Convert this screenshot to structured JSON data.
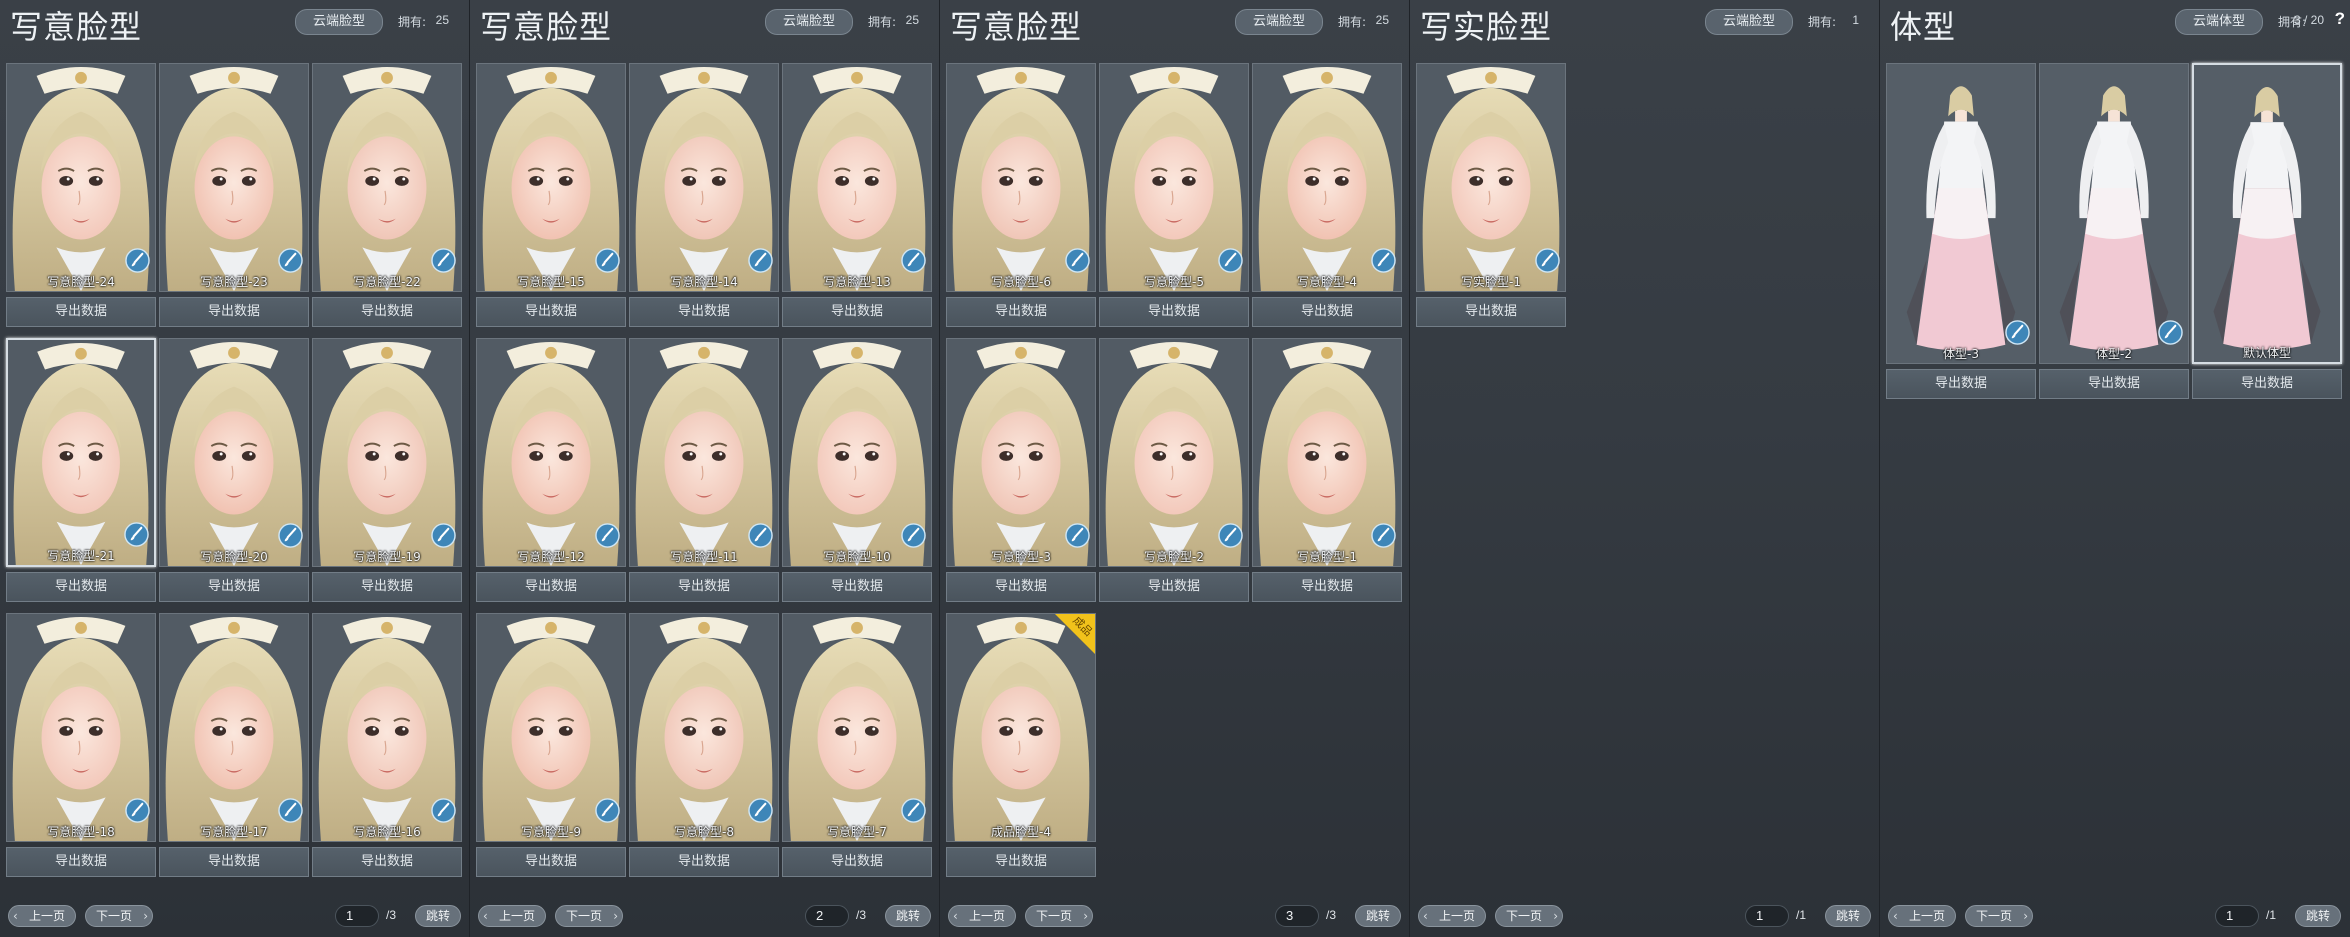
{
  "common": {
    "export_label": "导出数据",
    "owned_label": "拥有:",
    "prev_label": "上一页",
    "next_label": "下一页",
    "jump_label": "跳转"
  },
  "panels": [
    {
      "title": "写意脸型",
      "cloud_button": "云端脸型",
      "owned": "25",
      "page_current": "1",
      "page_total": "/3",
      "items": [
        {
          "label": "写意脸型-24",
          "kind": "face",
          "brush": true,
          "selected": false
        },
        {
          "label": "写意脸型-23",
          "kind": "face",
          "brush": true,
          "selected": false
        },
        {
          "label": "写意脸型-22",
          "kind": "face",
          "brush": true,
          "selected": false
        },
        {
          "label": "写意脸型-21",
          "kind": "face",
          "brush": true,
          "selected": true
        },
        {
          "label": "写意脸型-20",
          "kind": "face",
          "brush": true,
          "selected": false
        },
        {
          "label": "写意脸型-19",
          "kind": "face",
          "brush": true,
          "selected": false
        },
        {
          "label": "写意脸型-18",
          "kind": "face",
          "brush": true,
          "selected": false
        },
        {
          "label": "写意脸型-17",
          "kind": "face",
          "brush": true,
          "selected": false
        },
        {
          "label": "写意脸型-16",
          "kind": "face",
          "brush": true,
          "selected": false
        }
      ]
    },
    {
      "title": "写意脸型",
      "cloud_button": "云端脸型",
      "owned": "25",
      "page_current": "2",
      "page_total": "/3",
      "items": [
        {
          "label": "写意脸型-15",
          "kind": "face",
          "brush": true,
          "selected": false
        },
        {
          "label": "写意脸型-14",
          "kind": "face",
          "brush": true,
          "selected": false
        },
        {
          "label": "写意脸型-13",
          "kind": "face",
          "brush": true,
          "selected": false
        },
        {
          "label": "写意脸型-12",
          "kind": "face",
          "brush": true,
          "selected": false
        },
        {
          "label": "写意脸型-11",
          "kind": "face",
          "brush": true,
          "selected": false
        },
        {
          "label": "写意脸型-10",
          "kind": "face",
          "brush": true,
          "selected": false
        },
        {
          "label": "写意脸型-9",
          "kind": "face",
          "brush": true,
          "selected": false
        },
        {
          "label": "写意脸型-8",
          "kind": "face",
          "brush": true,
          "selected": false
        },
        {
          "label": "写意脸型-7",
          "kind": "face",
          "brush": true,
          "selected": false
        }
      ]
    },
    {
      "title": "写意脸型",
      "cloud_button": "云端脸型",
      "owned": "25",
      "page_current": "3",
      "page_total": "/3",
      "items": [
        {
          "label": "写意脸型-6",
          "kind": "face",
          "brush": true,
          "selected": false
        },
        {
          "label": "写意脸型-5",
          "kind": "face",
          "brush": true,
          "selected": false
        },
        {
          "label": "写意脸型-4",
          "kind": "face",
          "brush": true,
          "selected": false
        },
        {
          "label": "写意脸型-3",
          "kind": "face",
          "brush": true,
          "selected": false
        },
        {
          "label": "写意脸型-2",
          "kind": "face",
          "brush": true,
          "selected": false
        },
        {
          "label": "写意脸型-1",
          "kind": "face",
          "brush": true,
          "selected": false
        },
        {
          "label": "成品脸型-4",
          "kind": "face",
          "brush": false,
          "selected": false,
          "badge": "成品"
        }
      ]
    },
    {
      "title": "写实脸型",
      "cloud_button": "云端脸型",
      "owned": "1",
      "page_current": "1",
      "page_total": "/1",
      "items": [
        {
          "label": "写实脸型-1",
          "kind": "face",
          "brush": true,
          "selected": false
        }
      ]
    },
    {
      "title": "体型",
      "cloud_button": "云端体型",
      "owned": "3 / 20",
      "help": "?",
      "page_current": "1",
      "page_total": "/1",
      "items": [
        {
          "label": "体型-3",
          "kind": "body",
          "brush": true,
          "selected": false
        },
        {
          "label": "体型-2",
          "kind": "body",
          "brush": true,
          "selected": false
        },
        {
          "label": "默认体型",
          "kind": "body",
          "brush": false,
          "selected": true
        }
      ]
    }
  ]
}
